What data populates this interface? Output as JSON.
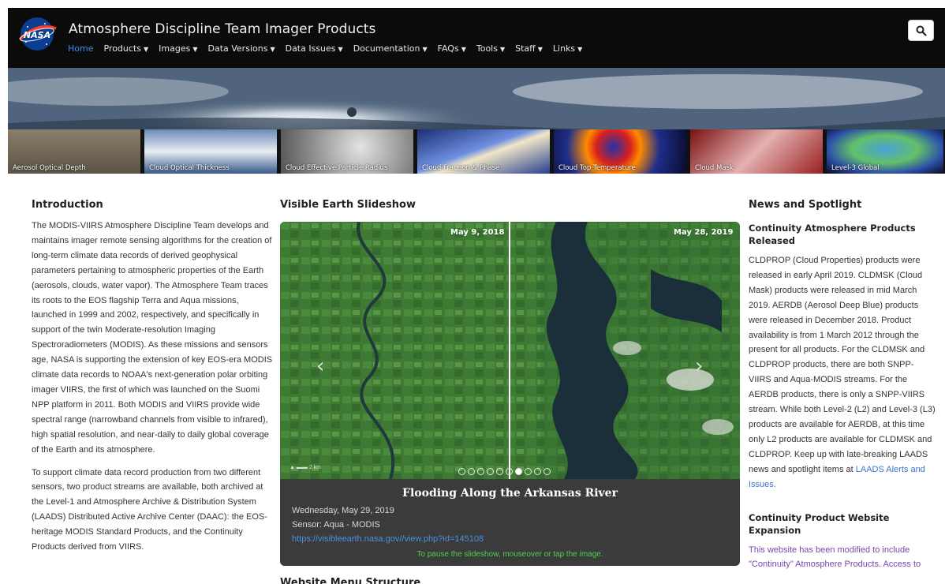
{
  "header": {
    "title": "Atmosphere Discipline Team Imager Products",
    "logo_text": "NASA",
    "nav": [
      {
        "label": "Home",
        "active": true,
        "dropdown": false
      },
      {
        "label": "Products",
        "dropdown": true
      },
      {
        "label": "Images",
        "dropdown": true
      },
      {
        "label": "Data Versions",
        "dropdown": true
      },
      {
        "label": "Data Issues",
        "dropdown": true
      },
      {
        "label": "Documentation",
        "dropdown": true
      },
      {
        "label": "FAQs",
        "dropdown": true
      },
      {
        "label": "Tools",
        "dropdown": true
      },
      {
        "label": "Staff",
        "dropdown": true
      },
      {
        "label": "Links",
        "dropdown": true
      }
    ],
    "search_icon": "search-icon"
  },
  "thumbnails": [
    {
      "label": "Aerosol Optical Depth"
    },
    {
      "label": "Cloud Optical Thickness"
    },
    {
      "label": "Cloud Effective Particle Radius"
    },
    {
      "label": "Cloud Fraction & Phase"
    },
    {
      "label": "Cloud Top Temperature"
    },
    {
      "label": "Cloud Mask"
    },
    {
      "label": "Level-3 Global"
    }
  ],
  "intro": {
    "title": "Introduction",
    "p1": "The MODIS-VIIRS Atmosphere Discipline Team develops and maintains imager remote sensing algorithms for the creation of long-term climate data records of derived geophysical parameters pertaining to atmospheric properties of the Earth (aerosols, clouds, water vapor). The Atmosphere Team traces its roots to the EOS flagship Terra and Aqua missions, launched in 1999 and 2002, respectively, and specifically in support of the twin Moderate-resolution Imaging Spectroradiometers (MODIS). As these missions and sensors age, NASA is supporting the extension of key EOS-era MODIS climate data records to NOAA's next-generation polar orbiting imager VIIRS, the first of which was launched on the Suomi NPP platform in 2011. Both MODIS and VIIRS provide wide spectral range (narrowband channels from visible to infrared), high spatial resolution, and near-daily to daily global coverage of the Earth and its atmosphere.",
    "p2": "To support climate data record production from two different sensors, two product streams are available, both archived at the Level-1 and Atmosphere Archive & Distribution System (LAADS) Distributed Active Archive Center (DAAC): the EOS-heritage MODIS Standard Products, and the Continuity Products derived from VIIRS."
  },
  "slideshow": {
    "title": "Visible Earth Slideshow",
    "date_left": "May 9, 2018",
    "date_right": "May 28, 2019",
    "slide_title": "Flooding Along the Arkansas River",
    "date_line": "Wednesday, May 29, 2019",
    "sensor_line": "Sensor: Aqua - MODIS",
    "link": "https://visibleearth.nasa.gov//view.php?id=145108",
    "pause_text": "To pause the slideshow, mouseover or tap the image.",
    "prev_label": "‹",
    "next_label": "›",
    "scale_label": "2 km",
    "dots_total": 10,
    "dot_active": 6
  },
  "menu_structure": {
    "title": "Website Menu Structure"
  },
  "news": {
    "title": "News and Spotlight",
    "item1_title": "Continuity Atmosphere Products Released",
    "item1_text": "CLDPROP (Cloud Properties) products were released in early April 2019. CLDMSK (Cloud Mask) products were released in mid March 2019. AERDB (Aerosol Deep Blue) products were released in December 2018.  Product availability is from 1 March 2012 through the present for all products. For the CLDMSK and CLDPROP products, there are both SNPP-VIIRS and Aqua-MODIS streams. For the AERDB products, there is only a SNPP-VIIRS stream. While both Level-2 (L2) and Level-3 (L3) products are available for AERDB, at this time only L2 products are available for CLDMSK and CLDPROP. Keep up with late-breaking LAADS news and spotlight items at",
    "item1_link": "LAADS Alerts and Issues.",
    "item2_title": "Continuity Product Website Expansion",
    "item2_text": "This website has been modified to include \"Continuity\" Atmosphere Products. Access to"
  }
}
